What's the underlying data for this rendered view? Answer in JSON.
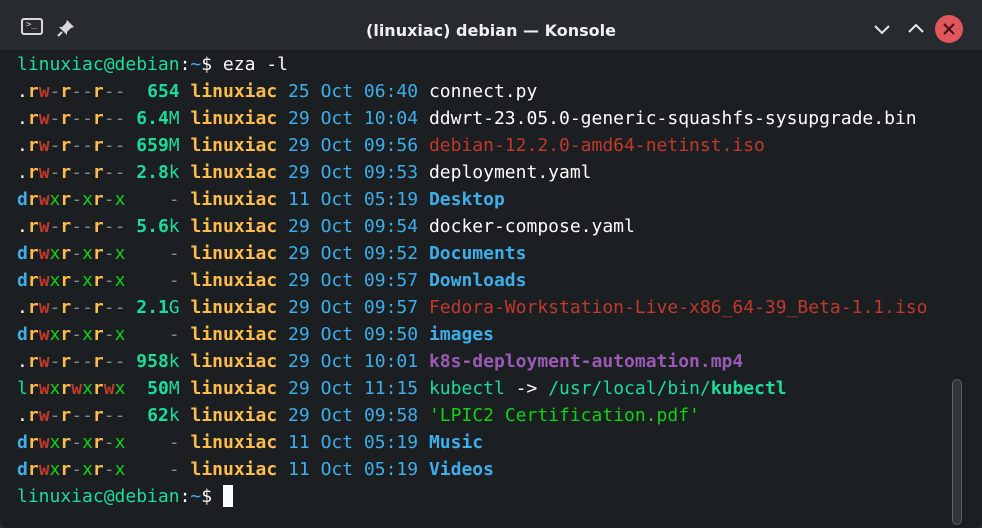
{
  "window": {
    "title": "(linuxiac) debian — Konsole",
    "icons": {
      "app": "terminal-icon",
      "pin": "pin-icon",
      "minimize": "chevron-down-icon",
      "maximize": "chevron-up-icon",
      "close": "close-icon"
    },
    "colors": {
      "close": "#e0565b",
      "background": "#1c1f22",
      "titlebar": "#272b2f"
    }
  },
  "prompt": {
    "user_host": "linuxiac@debian",
    "colon": ":",
    "path": "~",
    "symbol": "$",
    "command": " eza -l"
  },
  "listing": [
    {
      "perm": [
        ".",
        "r",
        "w",
        "-",
        "r",
        "-",
        "-",
        "r",
        "-",
        "-"
      ],
      "size_num": "654",
      "size_unit": "",
      "owner": "linuxiac",
      "day": "25",
      "month": "Oct",
      "time": "06:40",
      "name": "connect.py",
      "kind": "file"
    },
    {
      "perm": [
        ".",
        "r",
        "w",
        "-",
        "r",
        "-",
        "-",
        "r",
        "-",
        "-"
      ],
      "size_num": "6.4",
      "size_unit": "M",
      "owner": "linuxiac",
      "day": "29",
      "month": "Oct",
      "time": "10:04",
      "name": "ddwrt-23.05.0-generic-squashfs-sysupgrade.bin",
      "kind": "file"
    },
    {
      "perm": [
        ".",
        "r",
        "w",
        "-",
        "r",
        "-",
        "-",
        "r",
        "-",
        "-"
      ],
      "size_num": "659",
      "size_unit": "M",
      "owner": "linuxiac",
      "day": "29",
      "month": "Oct",
      "time": "09:56",
      "name": "debian-12.2.0-amd64-netinst.iso",
      "kind": "archive"
    },
    {
      "perm": [
        ".",
        "r",
        "w",
        "-",
        "r",
        "-",
        "-",
        "r",
        "-",
        "-"
      ],
      "size_num": "2.8",
      "size_unit": "k",
      "owner": "linuxiac",
      "day": "29",
      "month": "Oct",
      "time": "09:53",
      "name": "deployment.yaml",
      "kind": "file"
    },
    {
      "perm": [
        "d",
        "r",
        "w",
        "x",
        "r",
        "-",
        "x",
        "r",
        "-",
        "x"
      ],
      "size_num": "-",
      "size_unit": "",
      "owner": "linuxiac",
      "day": "11",
      "month": "Oct",
      "time": "05:19",
      "name": "Desktop",
      "kind": "dir"
    },
    {
      "perm": [
        ".",
        "r",
        "w",
        "-",
        "r",
        "-",
        "-",
        "r",
        "-",
        "-"
      ],
      "size_num": "5.6",
      "size_unit": "k",
      "owner": "linuxiac",
      "day": "29",
      "month": "Oct",
      "time": "09:54",
      "name": "docker-compose.yaml",
      "kind": "file"
    },
    {
      "perm": [
        "d",
        "r",
        "w",
        "x",
        "r",
        "-",
        "x",
        "r",
        "-",
        "x"
      ],
      "size_num": "-",
      "size_unit": "",
      "owner": "linuxiac",
      "day": "29",
      "month": "Oct",
      "time": "09:52",
      "name": "Documents",
      "kind": "dir"
    },
    {
      "perm": [
        "d",
        "r",
        "w",
        "x",
        "r",
        "-",
        "x",
        "r",
        "-",
        "x"
      ],
      "size_num": "-",
      "size_unit": "",
      "owner": "linuxiac",
      "day": "29",
      "month": "Oct",
      "time": "09:57",
      "name": "Downloads",
      "kind": "dir"
    },
    {
      "perm": [
        ".",
        "r",
        "w",
        "-",
        "r",
        "-",
        "-",
        "r",
        "-",
        "-"
      ],
      "size_num": "2.1",
      "size_unit": "G",
      "owner": "linuxiac",
      "day": "29",
      "month": "Oct",
      "time": "09:57",
      "name": "Fedora-Workstation-Live-x86_64-39_Beta-1.1.iso",
      "kind": "archive"
    },
    {
      "perm": [
        "d",
        "r",
        "w",
        "x",
        "r",
        "-",
        "x",
        "r",
        "-",
        "x"
      ],
      "size_num": "-",
      "size_unit": "",
      "owner": "linuxiac",
      "day": "29",
      "month": "Oct",
      "time": "09:50",
      "name": "images",
      "kind": "dir"
    },
    {
      "perm": [
        ".",
        "r",
        "w",
        "-",
        "r",
        "-",
        "-",
        "r",
        "-",
        "-"
      ],
      "size_num": "958",
      "size_unit": "k",
      "owner": "linuxiac",
      "day": "29",
      "month": "Oct",
      "time": "10:01",
      "name": "k8s-deployment-automation.mp4",
      "kind": "video"
    },
    {
      "perm": [
        "l",
        "r",
        "w",
        "x",
        "r",
        "w",
        "x",
        "r",
        "w",
        "x"
      ],
      "size_num": "50",
      "size_unit": "M",
      "owner": "linuxiac",
      "day": "29",
      "month": "Oct",
      "time": "11:15",
      "name": "kubectl",
      "kind": "link",
      "link_arrow": "->",
      "link_dir": "/usr/local/bin/",
      "link_target": "kubectl"
    },
    {
      "perm": [
        ".",
        "r",
        "w",
        "-",
        "r",
        "-",
        "-",
        "r",
        "-",
        "-"
      ],
      "size_num": "62",
      "size_unit": "k",
      "owner": "linuxiac",
      "day": "29",
      "month": "Oct",
      "time": "09:58",
      "name": "'LPIC2 Certification.pdf'",
      "kind": "doc"
    },
    {
      "perm": [
        "d",
        "r",
        "w",
        "x",
        "r",
        "-",
        "x",
        "r",
        "-",
        "x"
      ],
      "size_num": "-",
      "size_unit": "",
      "owner": "linuxiac",
      "day": "11",
      "month": "Oct",
      "time": "05:19",
      "name": "Music",
      "kind": "dir"
    },
    {
      "perm": [
        "d",
        "r",
        "w",
        "x",
        "r",
        "-",
        "x",
        "r",
        "-",
        "x"
      ],
      "size_num": "-",
      "size_unit": "",
      "owner": "linuxiac",
      "day": "11",
      "month": "Oct",
      "time": "05:19",
      "name": "Videos",
      "kind": "dir"
    }
  ],
  "final_prompt": {
    "user_host": "linuxiac@debian",
    "colon": ":",
    "path": "~",
    "symbol": "$",
    "command": " "
  }
}
